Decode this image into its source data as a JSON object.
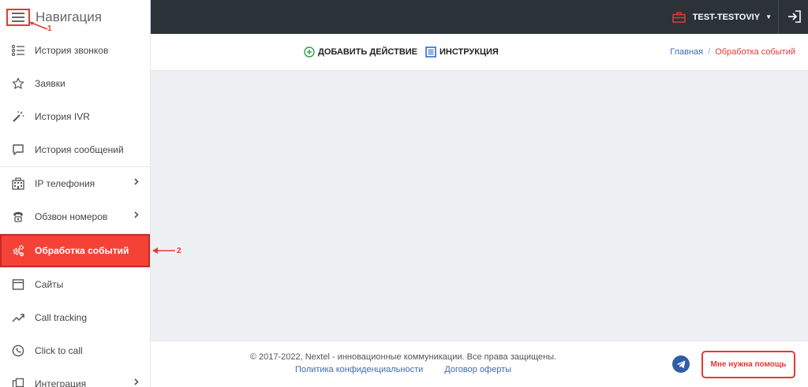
{
  "sidebar": {
    "title": "Навигация",
    "items": [
      {
        "label": "История звонков",
        "icon": "list-icon"
      },
      {
        "label": "Заявки",
        "icon": "star-icon"
      },
      {
        "label": "История IVR",
        "icon": "magic-wand-icon"
      },
      {
        "label": "История сообщений",
        "icon": "chat-icon"
      },
      {
        "label": "IP телефония",
        "icon": "building-icon"
      },
      {
        "label": "Обзвон номеров",
        "icon": "phone-icon"
      },
      {
        "label": "Обработка событий",
        "icon": "gears-icon"
      },
      {
        "label": "Сайты",
        "icon": "browser-window-icon"
      },
      {
        "label": "Call tracking",
        "icon": "trend-icon"
      },
      {
        "label": "Click to call",
        "icon": "phone-circle-icon"
      },
      {
        "label": "Интеграция",
        "icon": "integration-icon"
      }
    ]
  },
  "topbar": {
    "account_name": "TEST-TESTOVIY"
  },
  "actions": {
    "add_action": "ДОБАВИТЬ ДЕЙСТВИЕ",
    "instruction": "ИНСТРУКЦИЯ"
  },
  "breadcrumb": {
    "home": "Главная",
    "separator": "/",
    "current": "Обработка событий"
  },
  "footer": {
    "copyright": "© 2017-2022, Nextel - инновационные коммуникации. Все права защищены.",
    "privacy_link": "Политика конфиденциальности",
    "offer_link": "Договор оферты",
    "help_button": "Мне нужна помощь"
  },
  "annotations": {
    "marker_1": "1",
    "marker_2": "2"
  },
  "colors": {
    "accent": "#f44336",
    "topbar": "#2b3238",
    "link": "#3d6bb3"
  }
}
